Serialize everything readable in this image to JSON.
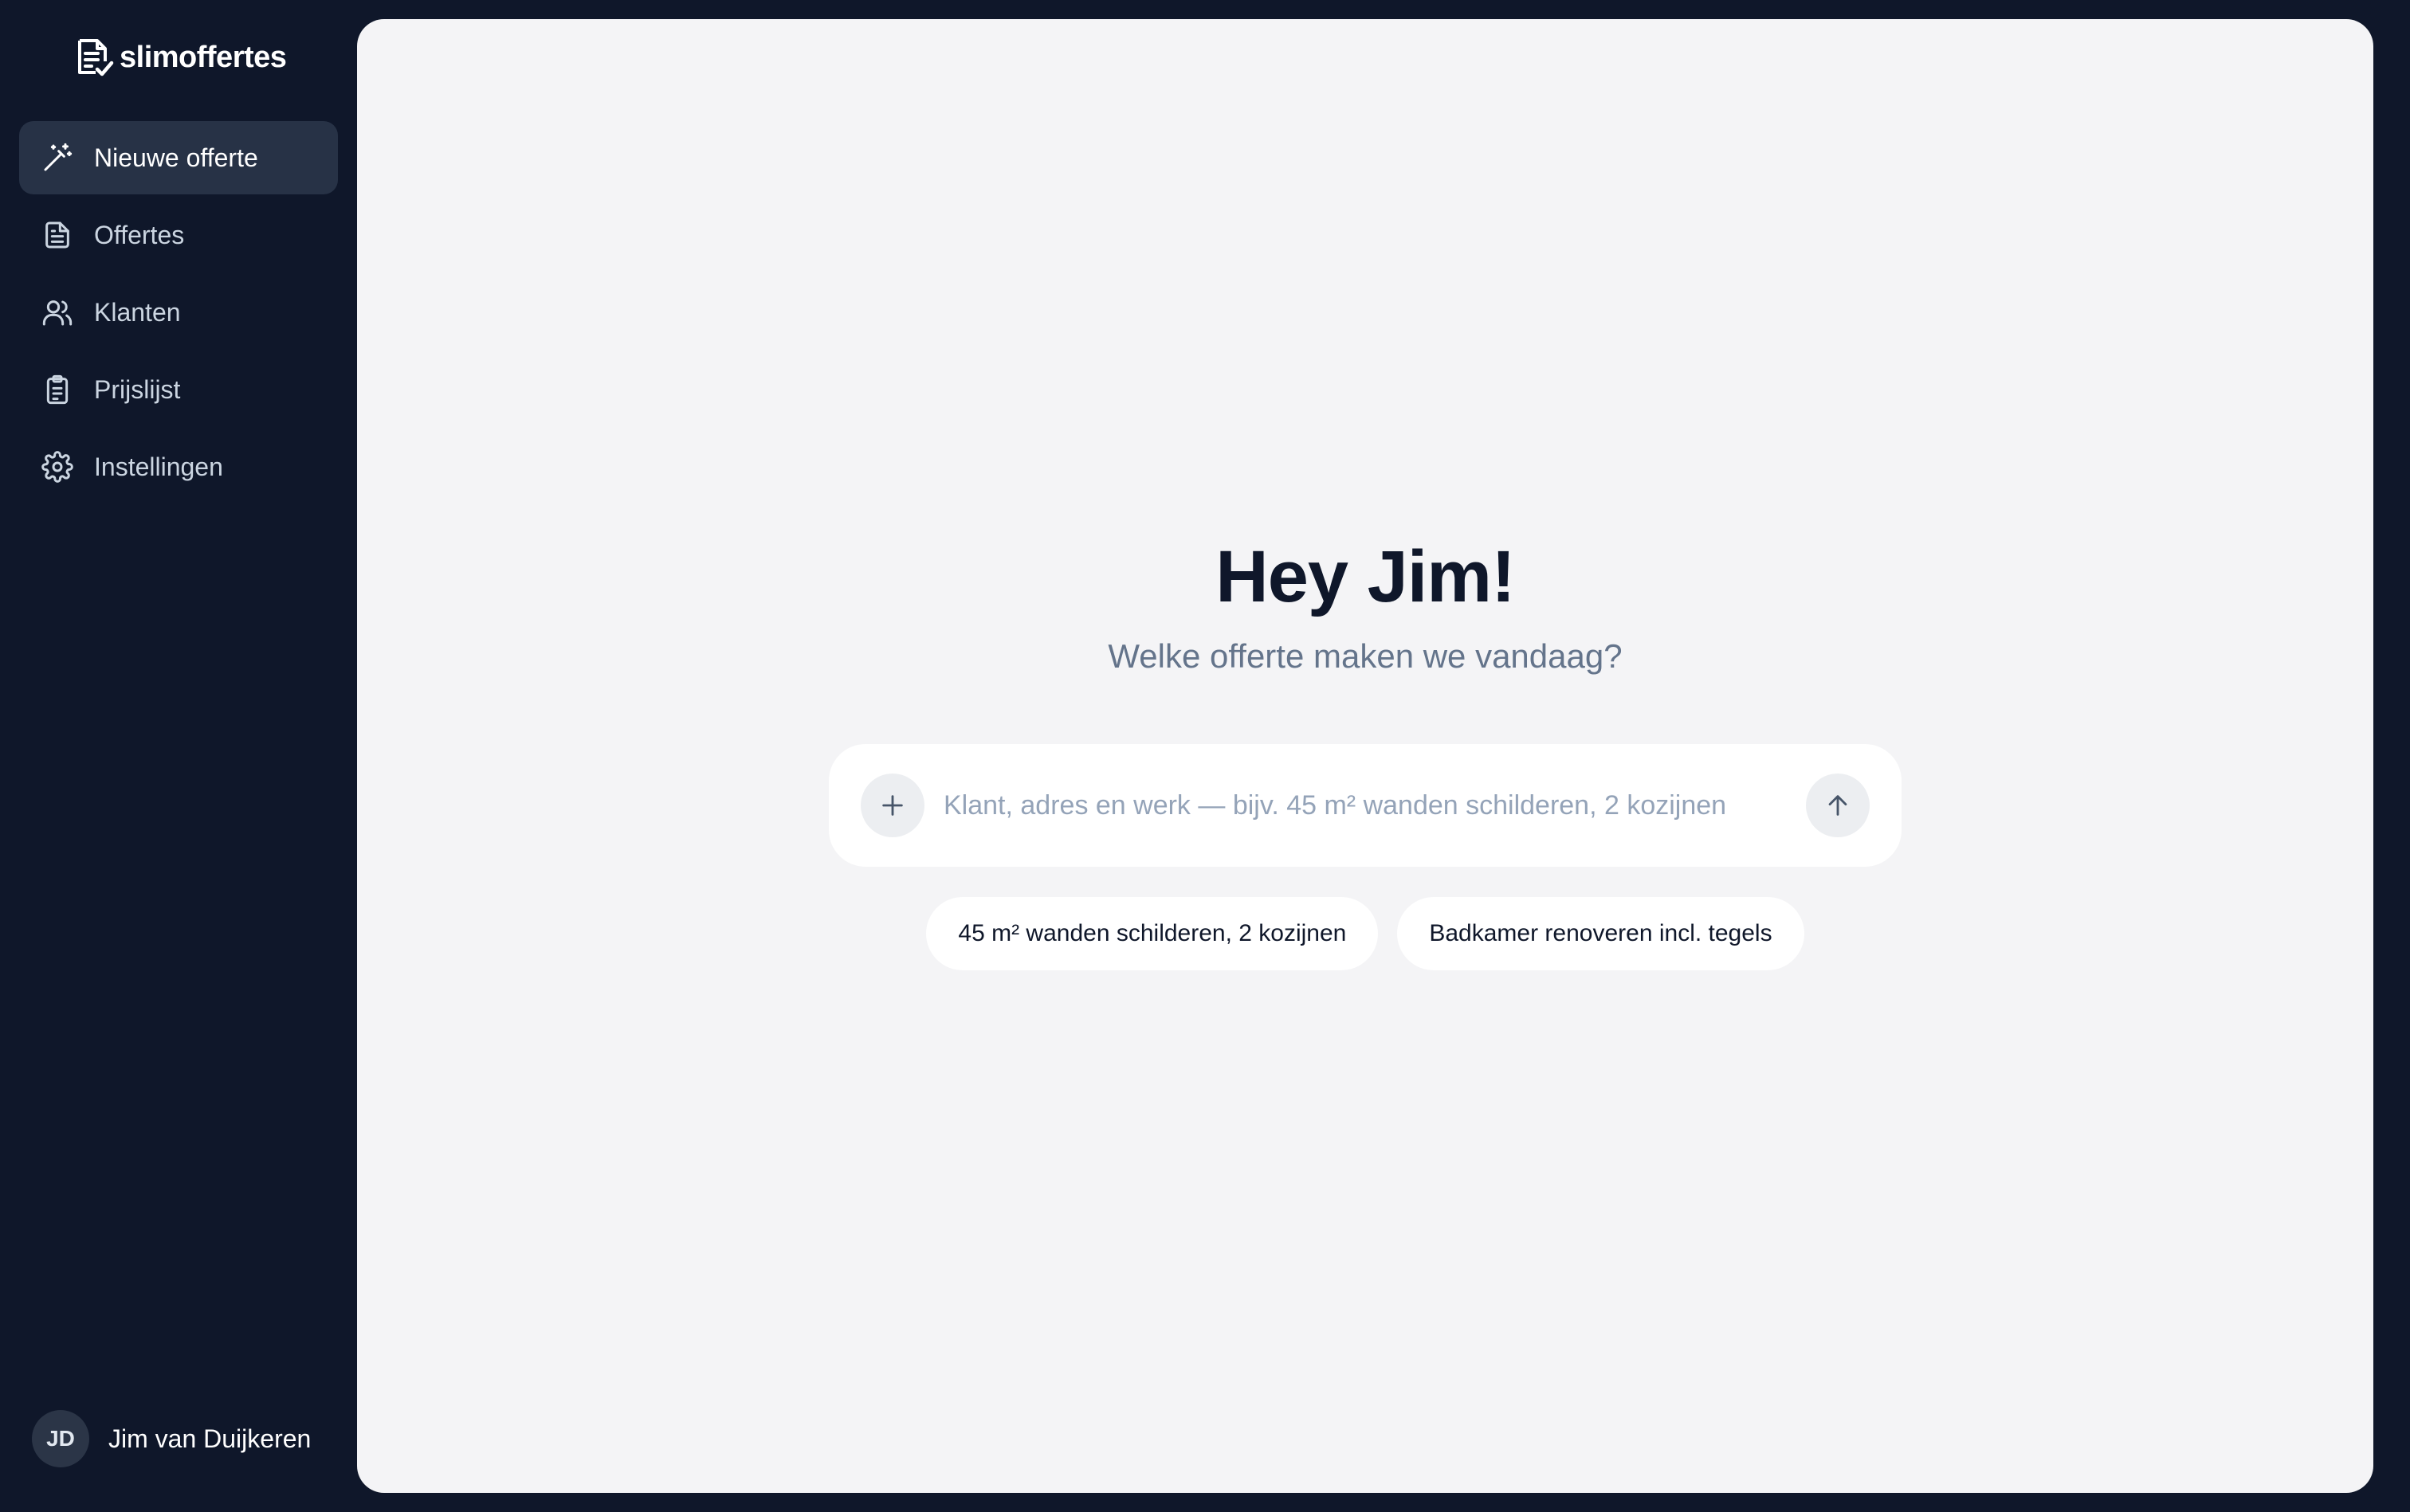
{
  "app": {
    "name": "slimoffertes"
  },
  "sidebar": {
    "items": [
      {
        "label": "Nieuwe offerte",
        "icon": "magic-wand-icon",
        "active": true
      },
      {
        "label": "Offertes",
        "icon": "document-icon",
        "active": false
      },
      {
        "label": "Klanten",
        "icon": "users-icon",
        "active": false
      },
      {
        "label": "Prijslijst",
        "icon": "clipboard-list-icon",
        "active": false
      },
      {
        "label": "Instellingen",
        "icon": "gear-icon",
        "active": false
      }
    ],
    "user": {
      "initials": "JD",
      "name": "Jim van Duijkeren"
    }
  },
  "main": {
    "greeting": "Hey Jim!",
    "subtitle": "Welke offerte maken we vandaag?",
    "composer": {
      "placeholder": "Klant, adres en werk — bijv. 45 m² wanden schilderen, 2 kozijnen",
      "value": "",
      "add_icon": "plus-icon",
      "send_icon": "arrow-up-icon"
    },
    "suggestions": [
      "45 m² wanden schilderen, 2 kozijnen",
      "Badkamer renoveren incl. tegels"
    ]
  },
  "colors": {
    "sidebar_bg": "#0f172a",
    "active_item_bg": "#273246",
    "main_bg": "#f4f4f6",
    "text_dark": "#0f172a",
    "text_muted": "#64748b"
  }
}
